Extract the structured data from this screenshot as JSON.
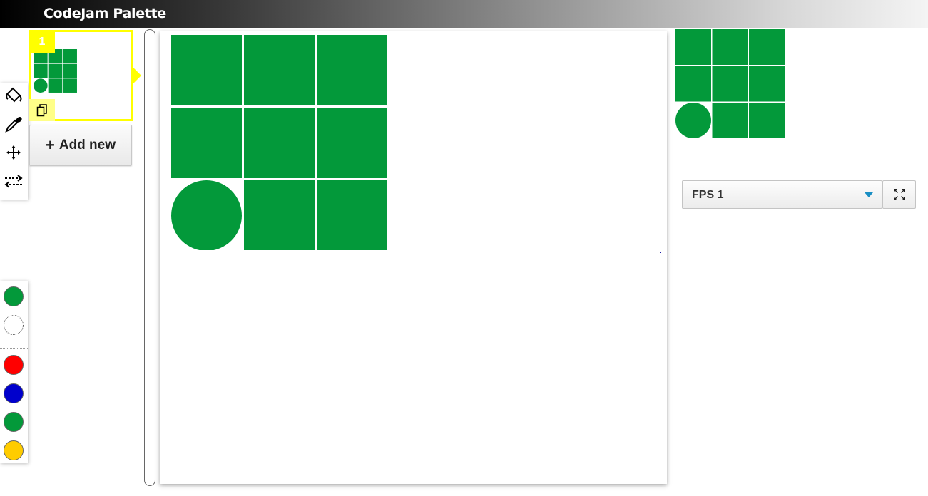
{
  "app": {
    "title": "CodeJam Palette"
  },
  "tools": [
    {
      "name": "paint-bucket-icon"
    },
    {
      "name": "eyedropper-icon"
    },
    {
      "name": "move-icon"
    },
    {
      "name": "swap-icon"
    }
  ],
  "palette": {
    "selected": [
      "#03993a",
      "#ffffff"
    ],
    "colors": [
      "#ff0000",
      "#0000cc",
      "#03993a",
      "#ffcc00"
    ]
  },
  "frames": [
    {
      "number": "1",
      "selected": true
    }
  ],
  "add_button": {
    "label": "Add new"
  },
  "grid": {
    "cells": [
      {
        "shape": "square",
        "color": "#03993a"
      },
      {
        "shape": "square",
        "color": "#03993a"
      },
      {
        "shape": "square",
        "color": "#03993a"
      },
      {
        "shape": "square",
        "color": "#03993a"
      },
      {
        "shape": "square",
        "color": "#03993a"
      },
      {
        "shape": "square",
        "color": "#03993a"
      },
      {
        "shape": "circle",
        "color": "#03993a"
      },
      {
        "shape": "square",
        "color": "#03993a"
      },
      {
        "shape": "square",
        "color": "#03993a"
      }
    ]
  },
  "fps": {
    "label": "FPS 1"
  },
  "colors": {
    "accent_yellow": "#ffff00",
    "grid_green": "#03993a",
    "caret_blue": "#1a8fc4"
  }
}
